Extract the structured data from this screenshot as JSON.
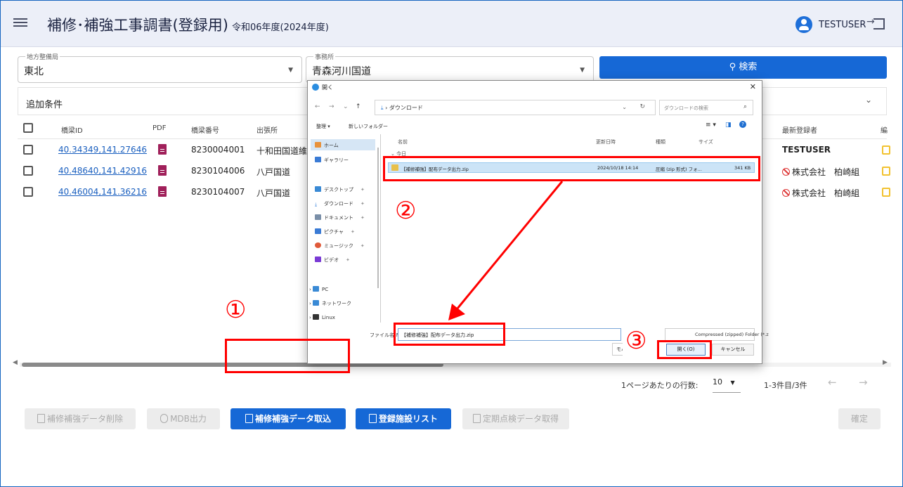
{
  "header": {
    "title": "補修･補強工事調書(登録用)",
    "year": "令和06年度(2024年度)",
    "user": "TESTUSER"
  },
  "filters": {
    "region_label": "地方整備局",
    "region_value": "東北",
    "office_label": "事務所",
    "office_value": "青森河川国道",
    "search_label": "検索"
  },
  "additional_conditions": "追加条件",
  "table": {
    "headers": [
      "橋梁ID",
      "PDF",
      "橋梁番号",
      "出張所",
      "最新登録者",
      "編"
    ],
    "rows": [
      {
        "id": "40.34349,141.27646",
        "number": "8230004001",
        "office": "十和田国道維持",
        "registrant": "TESTUSER",
        "blocked": false
      },
      {
        "id": "40.48640,141.42916",
        "number": "8230104006",
        "office": "八戸国道",
        "registrant": "株式会社　柏崎組",
        "blocked": true
      },
      {
        "id": "40.46004,141.36216",
        "number": "8230104007",
        "office": "八戸国道",
        "registrant": "株式会社　柏崎組",
        "blocked": true
      }
    ]
  },
  "pagination": {
    "rows_per_page_label": "1ページあたりの行数:",
    "rows_per_page": "10",
    "range": "1-3件目/3件"
  },
  "buttons": {
    "delete": "補修補強データ削除",
    "mdb": "MDB出力",
    "import": "補修補強データ取込",
    "list": "登録施設リスト",
    "periodic": "定期点検データ取得",
    "confirm": "確定"
  },
  "dialog": {
    "title": "開く",
    "path_root": "›",
    "path": "ダウンロード",
    "search_placeholder": "ダウンロードの検索",
    "organize": "整理 ▾",
    "new_folder": "新しいフォルダー",
    "col_name": "名前",
    "col_date": "更新日時",
    "col_type": "種類",
    "col_size": "サイズ",
    "group": "今日",
    "nav": [
      "ホーム",
      "ギャラリー",
      "デスクトップ",
      "ダウンロード",
      "ドキュメント",
      "ピクチャ",
      "ミュージック",
      "ビデオ",
      "PC",
      "ネットワーク",
      "Linux"
    ],
    "file": {
      "name": "【補修補強】配布データ出力.zip",
      "date": "2024/10/18 14:14",
      "type": "圧縮 (zip 形式) フォ...",
      "size": "341 KB"
    },
    "filename_label": "ファイル名(N):",
    "filename_value": "【補修補強】配布データ出力.zip",
    "filetype": "Compressed (zipped) Folder (*.z",
    "mobile": "モバイル",
    "open": "開く(O)",
    "cancel": "キャンセル"
  },
  "annotations": {
    "step1": "①",
    "step2": "②",
    "step3": "③",
    "color": "#ff0000"
  }
}
